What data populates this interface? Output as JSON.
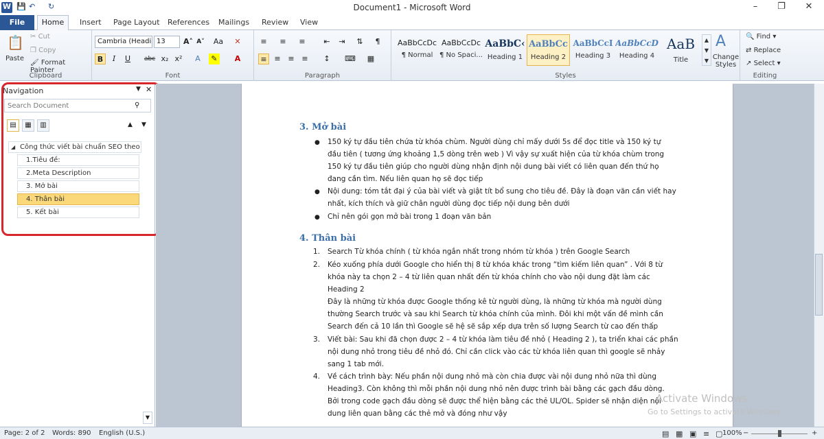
{
  "window": {
    "title": "Document1 - Microsoft Word"
  },
  "quick_access": {
    "logo": "W",
    "save_icon": "save-icon",
    "undo_icon": "undo-icon",
    "redo_icon": "redo-icon"
  },
  "tabs": [
    "File",
    "Home",
    "Insert",
    "Page Layout",
    "References",
    "Mailings",
    "Review",
    "View"
  ],
  "ribbon": {
    "clipboard": {
      "label": "Clipboard",
      "paste": "Paste",
      "cut": "Cut",
      "copy": "Copy",
      "format_painter": "Format Painter"
    },
    "font": {
      "label": "Font",
      "font_name": "Cambria (Headi",
      "font_size": "13"
    },
    "paragraph": {
      "label": "Paragraph"
    },
    "styles": {
      "label": "Styles",
      "items": [
        {
          "preview": "AaBbCcDc",
          "name": "¶ Normal"
        },
        {
          "preview": "AaBbCcDc",
          "name": "¶ No Spaci..."
        },
        {
          "preview": "AaBbC‹",
          "name": "Heading 1"
        },
        {
          "preview": "AaBbCc",
          "name": "Heading 2"
        },
        {
          "preview": "AaBbCcI",
          "name": "Heading 3"
        },
        {
          "preview": "AaBbCcD",
          "name": "Heading 4"
        },
        {
          "preview": "AaB",
          "name": "Title"
        }
      ],
      "change_styles": "Change Styles"
    },
    "editing": {
      "label": "Editing",
      "find": "Find",
      "replace": "Replace",
      "select": "Select"
    }
  },
  "navigation": {
    "title": "Navigation",
    "search_placeholder": "Search Document",
    "root": "Công thức viết bài chuẩn SEO theo ...",
    "items": [
      "1.Tiêu đề:",
      "2.Meta Description",
      "3. Mở bài",
      "4. Thân bài",
      "5. Kết bài"
    ],
    "active_index": 3
  },
  "document": {
    "h3": "3. Mở bài",
    "mobai": [
      [
        "150 ký tự đầu tiên chứa từ khóa chùm. Người dùng chỉ mấy dưới 5s để đọc title và 150 ký tự",
        "đầu tiên ( tương ứng khoảng 1,5 dòng trên web ) Vì vậy sự xuất hiện của từ khóa chùm trong",
        "150 ký tự đầu tiên giúp cho người dùng nhận định nội dung bài viết có liên quan đến thứ họ",
        "đang cần tìm. Nếu liên quan họ sẽ đọc tiếp"
      ],
      [
        "Nội dung: tóm tắt đại ý của bài viết và giật tít bổ sung cho tiêu đề. Đây là đoạn văn cần viết hay",
        "nhất, kích thích và giữ chân người dùng đọc tiếp nội dung bên dưới"
      ],
      [
        "Chỉ nên gói gọn mở bài trong 1 đoạn văn bản"
      ]
    ],
    "h4": "4. Thân bài",
    "thanbai": [
      {
        "n": "1.",
        "lines": [
          "Search Từ khóa chính ( từ khóa ngắn nhất trong nhóm từ khóa ) trên Google Search"
        ]
      },
      {
        "n": "2.",
        "lines": [
          "Kéo xuống phía dưới Google cho hiển thị 8 từ khóa khác trong “tìm kiếm liên quan” . Với 8 từ",
          "khóa này ta chọn 2 – 4 từ liên quan nhất đến từ khóa chính cho vào nội dung đặt làm các",
          "Heading 2",
          "Đây là những từ khóa được Google thống kê từ người dùng, là những từ khóa mà người dùng",
          "thường Search trước và sau khi Search từ khóa chính của mình. Đôi khi một vấn đề mình cần",
          "Search đến cả 10 lần thì Google sẽ hệ sẽ sắp xếp dựa trên số lượng Search từ cao đến thấp"
        ]
      },
      {
        "n": "3.",
        "lines": [
          "Viết bài: Sau khi đã chọn được 2 – 4 từ khóa làm tiêu đề nhỏ ( Heading 2 ), ta triển khai các phần",
          "nội dung nhỏ trong tiêu đề nhỏ đó. Chỉ cần click vào các từ khóa liên quan thì google sẽ nhảy",
          "sang 1 tab mới."
        ]
      },
      {
        "n": "4.",
        "lines": [
          "Về cách trình bày: Nếu phần nội dung nhỏ mà còn chia được vài nội dung nhỏ nữa thì dùng",
          "Heading3. Còn không thì mỗi phần nội dung nhỏ nên được trình bài bằng các gạch đầu dòng.",
          "Bởi trong code gạch đầu dòng sẽ được thể hiện bằng các thẻ UL/OL. Spider sẽ nhận diện nội",
          "dung liên quan bằng các thẻ mở và đóng như vậy"
        ]
      }
    ]
  },
  "watermark": {
    "line1": "Activate Windows",
    "line2": "Go to Settings to activate Windows."
  },
  "status": {
    "page": "Page: 2 of 2",
    "words": "Words: 890",
    "language": "English (U.S.)",
    "zoom": "100%"
  }
}
